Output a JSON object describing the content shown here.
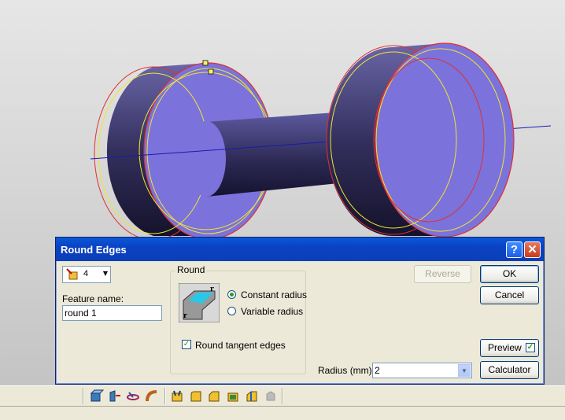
{
  "dialog": {
    "title": "Round Edges",
    "help_label": "?",
    "close_label": "✕",
    "selection_count": "4",
    "feature_name_label": "Feature name:",
    "feature_name_value": "round 1",
    "round_group_label": "Round",
    "constant_radius_label": "Constant radius",
    "variable_radius_label": "Variable radius",
    "radius_mode": "constant",
    "round_tangent_label": "Round tangent edges",
    "round_tangent_checked": true,
    "reverse_label": "Reverse",
    "ok_label": "OK",
    "cancel_label": "Cancel",
    "preview_label": "Preview",
    "preview_checked": true,
    "calculator_label": "Calculator",
    "radius_label": "Radius (mm):",
    "radius_value": "2"
  },
  "colors": {
    "part_face": "#7b72dc",
    "part_side_dark": "#23204a",
    "edge_highlight": "#e03030",
    "edge_yellow": "#f0e630",
    "title_blue": "#0a3fb7"
  },
  "toolbar_icons": [
    "extrude-icon",
    "revolve-icon",
    "sweep-icon",
    "loft-icon",
    "shell-icon",
    "round-edges-icon",
    "chamfer-icon",
    "draft-icon",
    "thicken-icon",
    "add-thickness-icon",
    "disabled-feature-icon"
  ]
}
